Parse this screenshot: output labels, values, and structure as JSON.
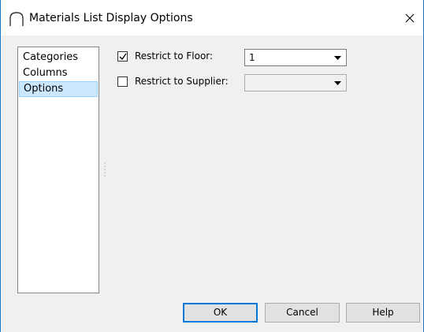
{
  "window": {
    "title": "Materials List Display Options",
    "close_glyph": "✕"
  },
  "categories_list": {
    "items": [
      {
        "label": "Categories",
        "selected": false
      },
      {
        "label": "Columns",
        "selected": false
      },
      {
        "label": "Options",
        "selected": true
      }
    ]
  },
  "options": {
    "restrict_floor": {
      "label": "Restrict to Floor:",
      "checked": true,
      "value": "1"
    },
    "restrict_supplier": {
      "label": "Restrict to Supplier:",
      "checked": false,
      "value": ""
    }
  },
  "buttons": {
    "ok": "OK",
    "cancel": "Cancel",
    "help": "Help"
  },
  "colors": {
    "selection_bg": "#cce8ff",
    "default_button_border": "#0078d7",
    "window_border": "#1979ca"
  }
}
